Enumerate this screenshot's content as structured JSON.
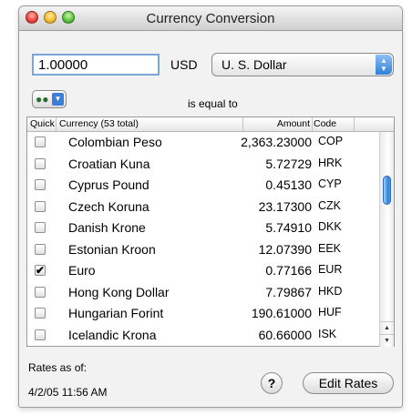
{
  "window": {
    "title": "Currency Conversion"
  },
  "converter": {
    "amount_value": "1.00000",
    "code": "USD",
    "selected_currency": "U. S. Dollar",
    "equal_label": "is equal to"
  },
  "table": {
    "headers": {
      "quick": "Quick",
      "currency": "Currency (53 total)",
      "amount": "Amount",
      "code": "Code"
    },
    "rows": [
      {
        "quick": false,
        "currency": "Colombian Peso",
        "amount": "2,363.23000",
        "code": "COP"
      },
      {
        "quick": false,
        "currency": "Croatian Kuna",
        "amount": "5.72729",
        "code": "HRK"
      },
      {
        "quick": false,
        "currency": "Cyprus Pound",
        "amount": "0.45130",
        "code": "CYP"
      },
      {
        "quick": false,
        "currency": "Czech Koruna",
        "amount": "23.17300",
        "code": "CZK"
      },
      {
        "quick": false,
        "currency": "Danish Krone",
        "amount": "5.74910",
        "code": "DKK"
      },
      {
        "quick": false,
        "currency": "Estonian Kroon",
        "amount": "12.07390",
        "code": "EEK"
      },
      {
        "quick": true,
        "currency": "Euro",
        "amount": "0.77166",
        "code": "EUR"
      },
      {
        "quick": false,
        "currency": "Hong Kong Dollar",
        "amount": "7.79867",
        "code": "HKD"
      },
      {
        "quick": false,
        "currency": "Hungarian Forint",
        "amount": "190.61000",
        "code": "HUF"
      },
      {
        "quick": false,
        "currency": "Icelandic Krona",
        "amount": "60.66000",
        "code": "ISK"
      }
    ]
  },
  "footer": {
    "rates_label": "Rates as of:",
    "rates_date": "4/2/05 11:56 AM",
    "help_label": "?",
    "edit_rates_label": "Edit Rates"
  },
  "colors": {
    "focus_ring": "#7aa6dc",
    "select_arrow": "#2f7fd6",
    "scroll_thumb": "#2f7fd6"
  },
  "icons": {
    "people": "people-icon",
    "chevron": "chevron-down-icon",
    "check": "checkmark-icon"
  }
}
